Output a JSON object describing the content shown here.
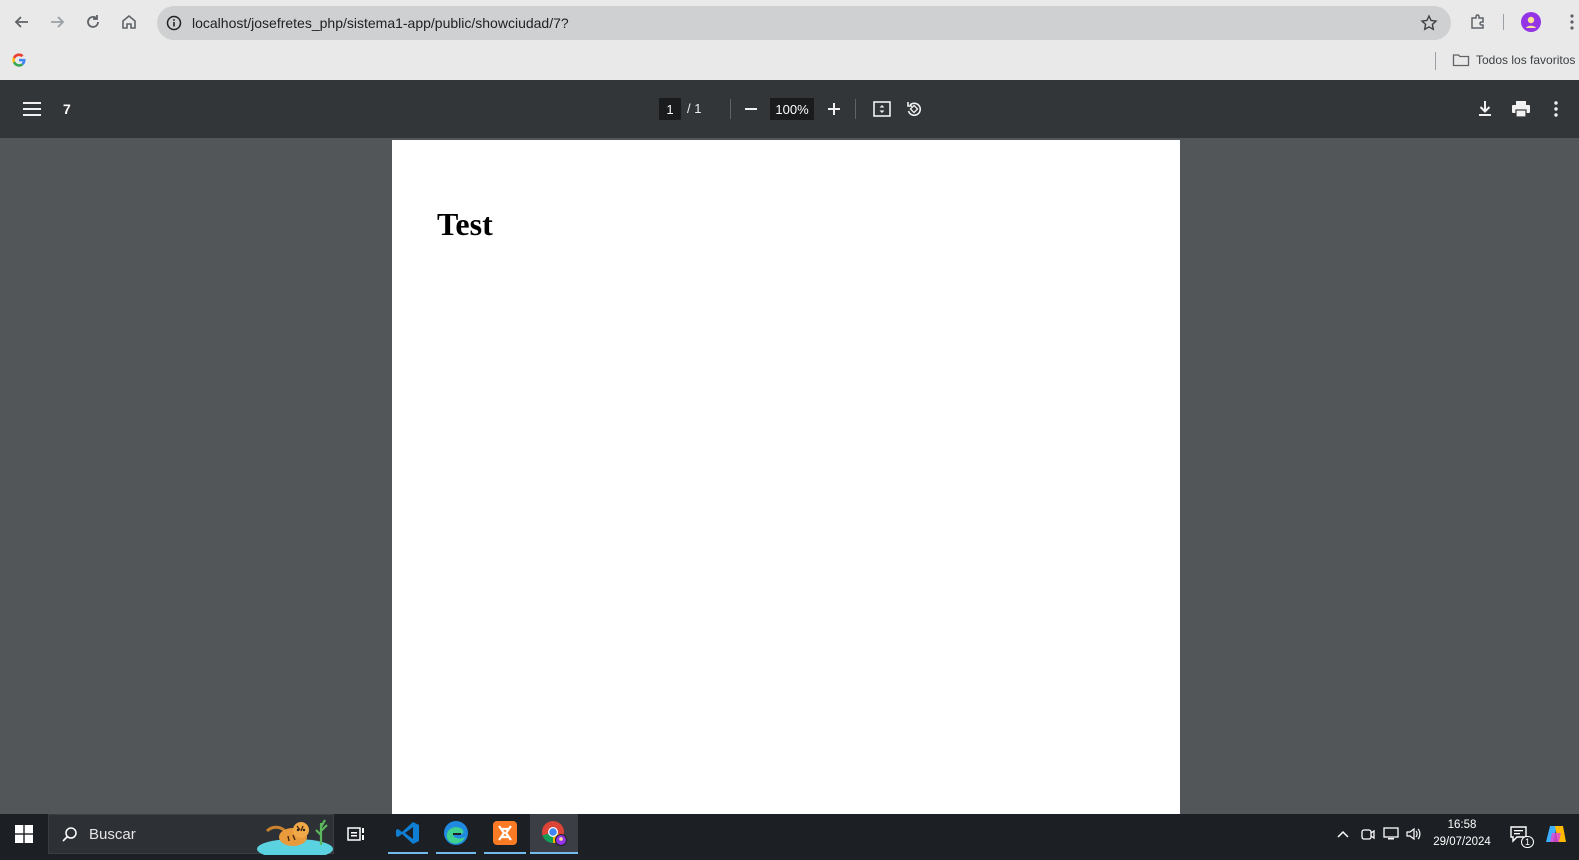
{
  "browser": {
    "url": "localhost/josefretes_php/sistema1-app/public/showciudad/7?",
    "bookmarks_folder_label": "Todos los favoritos"
  },
  "pdf_toolbar": {
    "title": "7",
    "current_page": "1",
    "page_total": "/  1",
    "zoom": "100%"
  },
  "document": {
    "heading": "Test"
  },
  "taskbar": {
    "search_label": "Buscar",
    "time": "16:58",
    "date": "29/07/2024",
    "notification_count": "1"
  },
  "colors": {
    "browser_chrome": "#e9e9e9",
    "pdf_toolbar": "#323639",
    "viewer_bg": "#525659",
    "taskbar": "#1c1f24"
  }
}
